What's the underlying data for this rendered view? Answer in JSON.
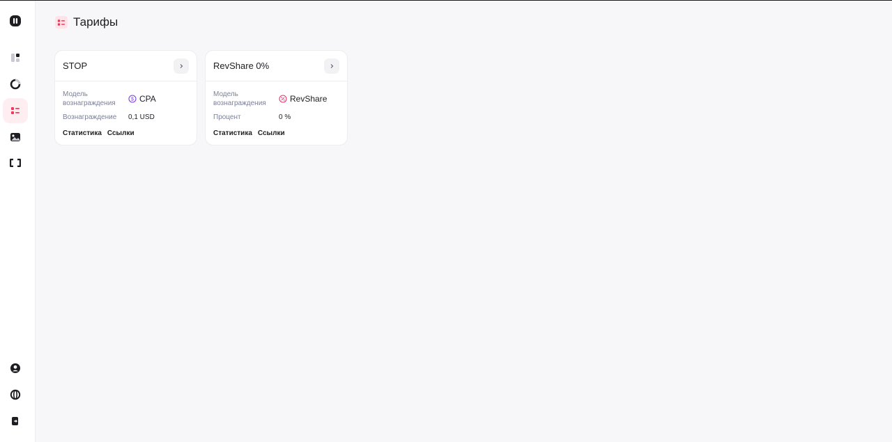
{
  "page": {
    "title": "Тарифы"
  },
  "colors": {
    "accent": "#f2385a",
    "accent_bg": "#ffeef1",
    "cpa_icon": "#7b3fe4",
    "revshare_icon": "#e8366f"
  },
  "sidebar": {
    "top_items": [
      {
        "icon": "logo-icon"
      },
      {
        "icon": "dashboard-icon"
      },
      {
        "icon": "pie-chart-icon"
      },
      {
        "icon": "tariffs-icon",
        "active": true
      },
      {
        "icon": "image-icon"
      },
      {
        "icon": "code-icon"
      }
    ],
    "bottom_items": [
      {
        "icon": "user-icon"
      },
      {
        "icon": "globe-icon"
      },
      {
        "icon": "logout-icon"
      }
    ]
  },
  "tariffs": [
    {
      "title": "STOP",
      "model_label": "Модель вознаграждения",
      "model_value": "CPA",
      "model_icon": "dollar-circle-icon",
      "second_label": "Вознаграждение",
      "second_value": "0,1 USD",
      "links": [
        "Статистика",
        "Ссылки"
      ]
    },
    {
      "title": "RevShare 0%",
      "model_label": "Модель вознаграждения",
      "model_value": "RevShare",
      "model_icon": "percent-circle-icon",
      "second_label": "Процент",
      "second_value": "0 %",
      "links": [
        "Статистика",
        "Ссылки"
      ]
    }
  ]
}
